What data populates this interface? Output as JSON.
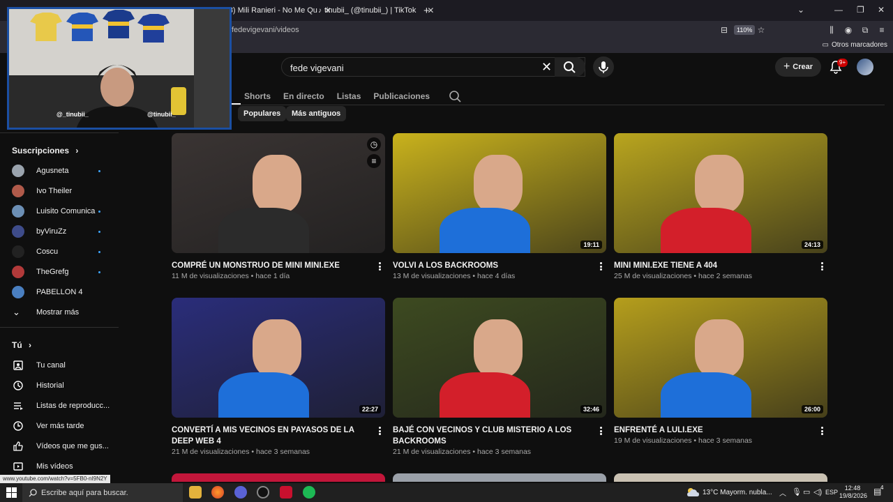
{
  "browser": {
    "tabs": [
      {
        "label": "(63) Mili Ranieri - No Me Qu",
        "icon": "youtube-favicon"
      },
      {
        "label": "tinubii_ (@tinubii_) | TikTok",
        "icon": "tiktok-favicon"
      }
    ],
    "url": "fedevigevani/videos",
    "zoom": "110%",
    "bookmarks_other": "Otros marcadores"
  },
  "youtube": {
    "search_value": "fede vigevani",
    "create_label": "Crear",
    "notif_badge": "9+",
    "channel_tabs": [
      "os",
      "Shorts",
      "En directo",
      "Listas",
      "Publicaciones"
    ],
    "selected_tab": "os",
    "chips": [
      "Populares",
      "Más antiguos"
    ]
  },
  "sidebar": {
    "subs_title": "Suscripciones",
    "subs": [
      {
        "label": "Agusneta",
        "dot": true,
        "color": "#9aa3ad"
      },
      {
        "label": "Ivo Theiler",
        "dot": false,
        "color": "#b05a4a"
      },
      {
        "label": "Luisito Comunica",
        "dot": true,
        "color": "#6c8fb5"
      },
      {
        "label": "byViruZz",
        "dot": true,
        "color": "#3e4c8a"
      },
      {
        "label": "Coscu",
        "dot": true,
        "color": "#222222"
      },
      {
        "label": "TheGrefg",
        "dot": true,
        "color": "#b23a3a"
      },
      {
        "label": "PABELLON 4",
        "dot": false,
        "color": "#4a7fc0"
      }
    ],
    "show_more": "Mostrar más",
    "you_title": "Tú",
    "you_items": [
      {
        "label": "Tu canal",
        "icon": "channel-icon"
      },
      {
        "label": "Historial",
        "icon": "history-icon"
      },
      {
        "label": "Listas de reproducc...",
        "icon": "playlists-icon"
      },
      {
        "label": "Ver más tarde",
        "icon": "watch-later-icon"
      },
      {
        "label": "Vídeos que me gus...",
        "icon": "like-icon"
      },
      {
        "label": "Mis vídeos",
        "icon": "my-videos-icon"
      }
    ]
  },
  "videos": [
    {
      "title": "COMPRÉ UN MONSTRUO DE MINI MINI.EXE",
      "views": "11 M de visualizaciones",
      "age": "hace 1 día",
      "duration": "",
      "bg": "#3a3433"
    },
    {
      "title": "VOLVI A LOS BACKROOMS",
      "views": "13 M de visualizaciones",
      "age": "hace 4 días",
      "duration": "19:11",
      "bg": "#c9b21c"
    },
    {
      "title": "MINI MINI.EXE TIENE A 404",
      "views": "25 M de visualizaciones",
      "age": "hace 2 semanas",
      "duration": "24:13",
      "bg": "#b9a51e"
    },
    {
      "title": "CONVERTÍ A MIS VECINOS EN PAYASOS DE LA DEEP WEB 4",
      "views": "21 M de visualizaciones",
      "age": "hace 3 semanas",
      "duration": "22:27",
      "bg": "#2a2d7a"
    },
    {
      "title": "BAJÉ CON VECINOS Y CLUB MISTERIO A LOS BACKROOMS",
      "views": "21 M de visualizaciones",
      "age": "hace 3 semanas",
      "duration": "32:46",
      "bg": "#3d4a20"
    },
    {
      "title": "ENFRENTÉ A LULI.EXE",
      "views": "19 M de visualizaciones",
      "age": "hace 3 semanas",
      "duration": "26:00",
      "bg": "#b59e1c"
    }
  ],
  "status_link": "www.youtube.com/watch?v=5FB0-nI9N2Y",
  "taskbar": {
    "search_placeholder": "Escribe aquí para buscar.",
    "weather": "13°C  Mayorm. nubla...",
    "lang": "ESP",
    "time": "12:48",
    "date": "19/8/2026"
  },
  "webcam": {
    "handle1": "@_tinubii_",
    "handle2": "@tinubii_"
  }
}
